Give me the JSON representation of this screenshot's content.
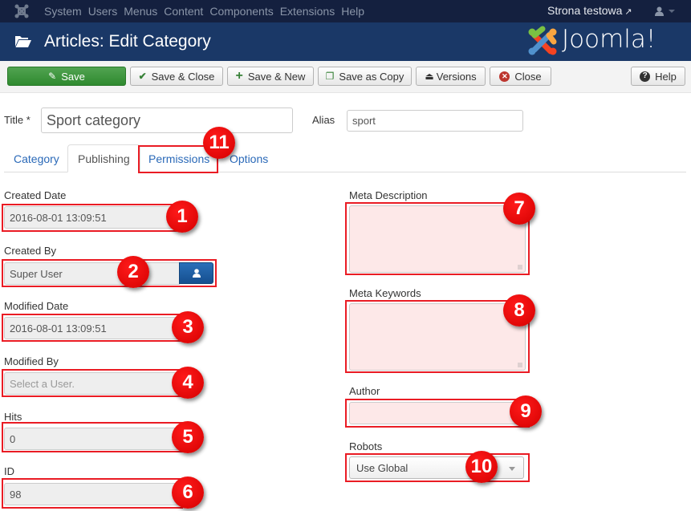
{
  "navbar": {
    "menu": [
      "System",
      "Users",
      "Menus",
      "Content",
      "Components",
      "Extensions",
      "Help"
    ],
    "site_link": "Strona testowa"
  },
  "header": {
    "title": "Articles: Edit Category",
    "brand": "Joomla!"
  },
  "toolbar": {
    "save": "Save",
    "save_close": "Save & Close",
    "save_new": "Save & New",
    "save_copy": "Save as Copy",
    "versions": "Versions",
    "close": "Close",
    "help": "Help"
  },
  "form": {
    "title_label": "Title *",
    "title_value": "Sport category",
    "alias_label": "Alias",
    "alias_value": "sport"
  },
  "tabs": [
    {
      "label": "Category",
      "active": false
    },
    {
      "label": "Publishing",
      "active": true
    },
    {
      "label": "Permissions",
      "active": false
    },
    {
      "label": "Options",
      "active": false
    }
  ],
  "publishing": {
    "created_date_label": "Created Date",
    "created_date": "2016-08-01 13:09:51",
    "created_by_label": "Created By",
    "created_by": "Super User",
    "modified_date_label": "Modified Date",
    "modified_date": "2016-08-01 13:09:51",
    "modified_by_label": "Modified By",
    "modified_by_placeholder": "Select a User.",
    "hits_label": "Hits",
    "hits": "0",
    "id_label": "ID",
    "id": "98"
  },
  "metadata": {
    "meta_description_label": "Meta Description",
    "meta_description": "",
    "meta_keywords_label": "Meta Keywords",
    "meta_keywords": "",
    "author_label": "Author",
    "author": "",
    "robots_label": "Robots",
    "robots": "Use Global"
  },
  "annotations": [
    "1",
    "2",
    "3",
    "4",
    "5",
    "6",
    "7",
    "8",
    "9",
    "10",
    "11"
  ],
  "colors": {
    "navbar": "#14203f",
    "header": "#1a3867",
    "save_button": "#3c963c",
    "annotation": "#ea1c24",
    "link": "#2a69b8"
  }
}
